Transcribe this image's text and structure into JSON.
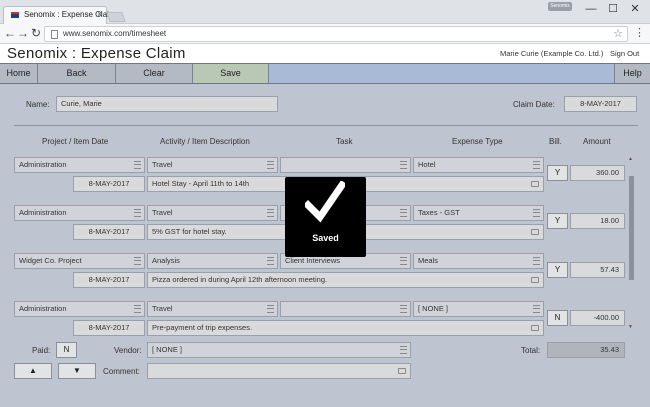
{
  "browser": {
    "tab_title": "Senomix : Expense Claim",
    "tab_close": "×",
    "user_badge": "Senomix",
    "window_controls": {
      "minimize": "—",
      "maximize": "☐",
      "close": "✕"
    },
    "nav": {
      "back": "←",
      "forward": "→",
      "reload": "↻"
    },
    "url": "www.senomix.com/timesheet",
    "star": "☆",
    "menu": "⋮"
  },
  "app": {
    "title": "Senomix : Expense Claim",
    "user": "Marie Curie   (Example Co. Ltd.)",
    "sign_out": "Sign Out"
  },
  "toolbar": {
    "home": "Home",
    "back": "Back",
    "clear": "Clear",
    "save": "Save",
    "help": "Help"
  },
  "form": {
    "name_label": "Name:",
    "name_value": "Curie, Marie",
    "claim_date_label": "Claim Date:",
    "claim_date_value": "8-MAY-2017"
  },
  "columns": {
    "project": "Project / Item Date",
    "activity": "Activity / Item Description",
    "task": "Task",
    "expense_type": "Expense Type",
    "billable": "Bill.",
    "amount": "Amount"
  },
  "entries": [
    {
      "project": "Administration",
      "date": "8-MAY-2017",
      "activity": "Travel",
      "description": "Hotel Stay - April 11th to 14th",
      "task": "",
      "expense_type": "Hotel",
      "billable": "Y",
      "amount": "360.00"
    },
    {
      "project": "Administration",
      "date": "8-MAY-2017",
      "activity": "Travel",
      "description": "5% GST for hotel stay.",
      "task": "",
      "expense_type": "Taxes - GST",
      "billable": "Y",
      "amount": "18.00"
    },
    {
      "project": "Widget Co. Project",
      "date": "8-MAY-2017",
      "activity": "Analysis",
      "description": "Pizza ordered in during April 12th afternoon meeting.",
      "task": "Client Interviews",
      "expense_type": "Meals",
      "billable": "Y",
      "amount": "57.43"
    },
    {
      "project": "Administration",
      "date": "8-MAY-2017",
      "activity": "Travel",
      "description": "Pre-payment of trip expenses.",
      "task": "",
      "expense_type": "[ NONE ]",
      "billable": "N",
      "amount": "-400.00"
    }
  ],
  "footer": {
    "paid_label": "Paid:",
    "paid_value": "N",
    "vendor_label": "Vendor:",
    "vendor_value": "[ NONE ]",
    "total_label": "Total:",
    "total_value": "35.43",
    "up_label": "▲",
    "down_label": "▼",
    "comment_label": "Comment:",
    "comment_value": ""
  },
  "scroll": {
    "up": "▲",
    "down": "▼"
  },
  "toast": {
    "text": "Saved"
  }
}
